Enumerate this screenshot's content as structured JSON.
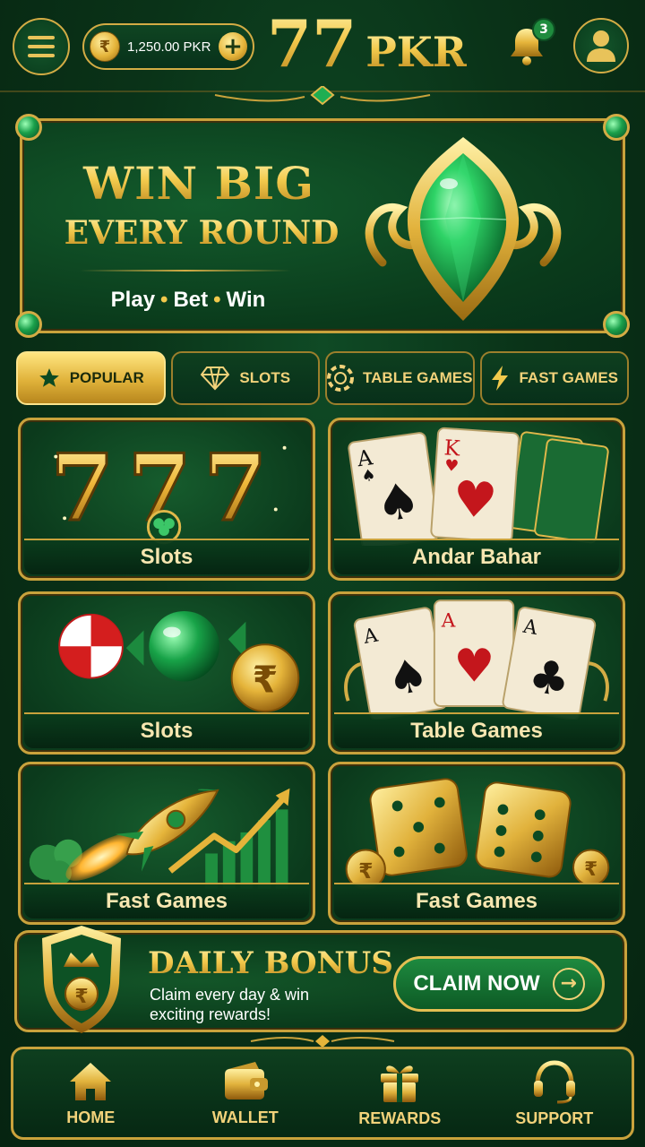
{
  "header": {
    "balance": "1,250.00 PKR",
    "logo_number": "77",
    "logo_currency": "PKR",
    "notification_count": "3"
  },
  "hero": {
    "title_line1": "WIN BIG",
    "title_line2": "EVERY ROUND",
    "subtitle": [
      "Play",
      "Bet",
      "Win"
    ]
  },
  "tabs": [
    {
      "label": "POPULAR",
      "icon": "star-icon",
      "active": true
    },
    {
      "label": "SLOTS",
      "icon": "diamond-icon",
      "active": false
    },
    {
      "label": "TABLE GAMES",
      "icon": "chip-icon",
      "active": false
    },
    {
      "label": "FAST GAMES",
      "icon": "lightning-icon",
      "active": false
    }
  ],
  "games": [
    {
      "label": "Slots",
      "art": "lucky-777-clover"
    },
    {
      "label": "Andar Bahar",
      "art": "ace-king-cards"
    },
    {
      "label": "Slots",
      "art": "candy-rupee-coin"
    },
    {
      "label": "Table Games",
      "art": "three-aces-cards"
    },
    {
      "label": "Fast Games",
      "art": "rocket-chart"
    },
    {
      "label": "Fast Games",
      "art": "gold-dice-coins"
    }
  ],
  "bonus": {
    "title": "DAILY BONUS",
    "description": "Claim every day & win exciting rewards!",
    "button_label": "CLAIM NOW"
  },
  "nav": [
    {
      "label": "HOME",
      "icon": "home-icon"
    },
    {
      "label": "WALLET",
      "icon": "wallet-icon"
    },
    {
      "label": "REWARDS",
      "icon": "gift-icon"
    },
    {
      "label": "SUPPORT",
      "icon": "headset-icon"
    }
  ],
  "colors": {
    "gold": "#d3ac45",
    "green_dark": "#0a3318",
    "green_accent": "#1f8b3e"
  }
}
